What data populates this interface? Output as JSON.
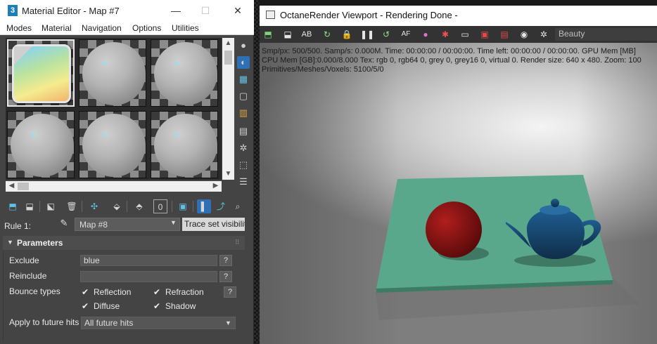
{
  "material_editor": {
    "title": "Material Editor - Map #7",
    "app_icon_label": "3",
    "window_buttons": {
      "minimize": "—",
      "maximize": "☐",
      "close": "✕"
    },
    "menu": [
      "Modes",
      "Material",
      "Navigation",
      "Options",
      "Utilities"
    ],
    "rule": {
      "label": "Rule 1:",
      "map_value": "Map #8",
      "trace_button": "Trace set visibility"
    },
    "parameters": {
      "title": "Parameters",
      "exclude_label": "Exclude",
      "exclude_value": "blue",
      "reinclude_label": "Reinclude",
      "reinclude_value": "",
      "help_label": "?",
      "bounce_types_label": "Bounce types",
      "bounce_types": [
        {
          "label": "Reflection",
          "checked": true
        },
        {
          "label": "Refraction",
          "checked": true
        },
        {
          "label": "Diffuse",
          "checked": true
        },
        {
          "label": "Shadow",
          "checked": true
        }
      ],
      "apply_label": "Apply to future hits",
      "apply_value": "All future hits"
    }
  },
  "octane_viewport": {
    "title": "OctaneRender Viewport - Rendering Done -",
    "render_pass": "Beauty",
    "stats": {
      "line1": "Smp/px: 500/500.   Samp/s: 0.000M.   Time: 00:00:00 / 00:00:00.   Time left: 00:00:00 / 00:00:00.   GPU Mem [MB]",
      "line2": "CPU Mem [GB]:0.000/8.000   Tex: rgb 0, rgb64 0, grey 0, grey16 0, virtual 0.   Render size: 640 x 480.   Zoom: 100",
      "line3": "Primitives/Meshes/Voxels: 5100/5/0"
    }
  },
  "colors": {
    "board": "#5aa88c",
    "sphere": "#b01e1e",
    "teapot": "#1f5e92",
    "selected_tool": "#2f6fb3"
  }
}
